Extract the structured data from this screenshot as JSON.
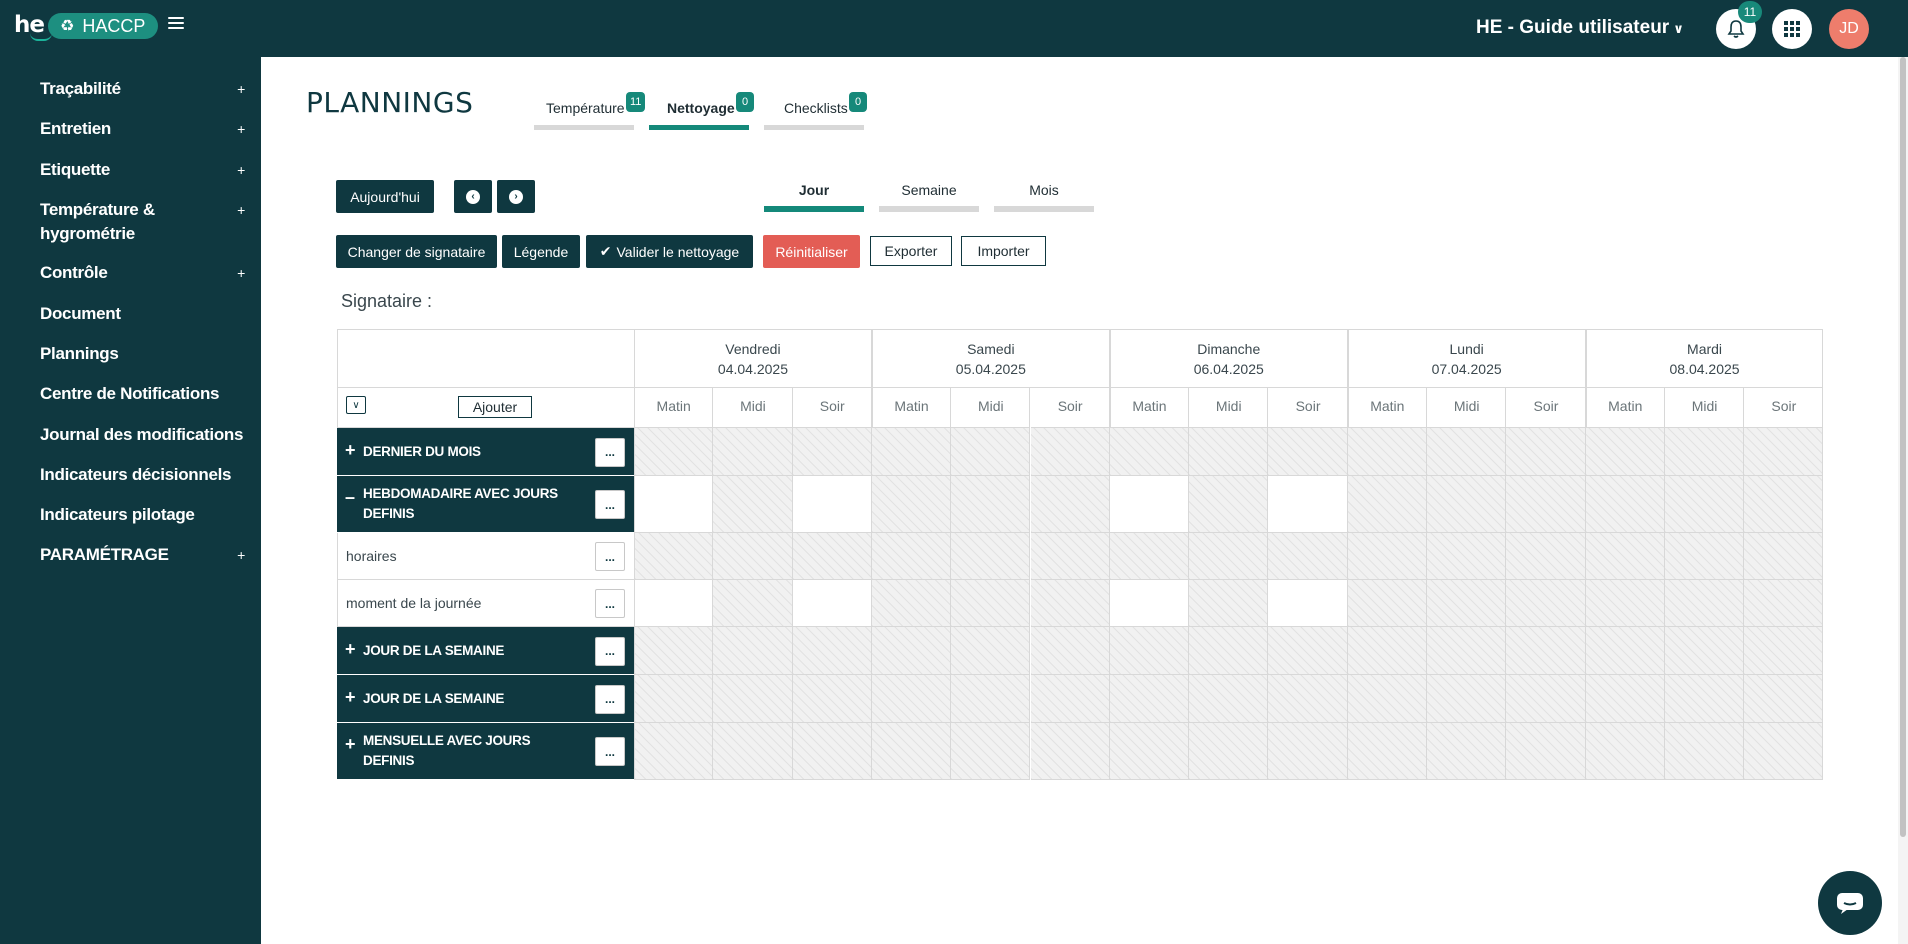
{
  "header": {
    "logo_text": "he",
    "app_name": "HACCP",
    "user_guide": "HE - Guide utilisateur",
    "notification_count": "11",
    "avatar_initials": "JD"
  },
  "sidebar": {
    "items": [
      {
        "label": "Traçabilité",
        "expandable": "+"
      },
      {
        "label": "Entretien",
        "expandable": "+"
      },
      {
        "label": "Etiquette",
        "expandable": "+"
      },
      {
        "label": "Température &",
        "label2": "hygrométrie",
        "expandable": "+"
      },
      {
        "label": "Contrôle",
        "expandable": "+"
      },
      {
        "label": "Document"
      },
      {
        "label": "Plannings"
      },
      {
        "label": "Centre de Notifications"
      },
      {
        "label": "Journal des modifications"
      },
      {
        "label": "Indicateurs décisionnels"
      },
      {
        "label": "Indicateurs pilotage"
      },
      {
        "label": "PARAMÉTRAGE",
        "expandable": "+"
      }
    ]
  },
  "main": {
    "title": "PLANNINGS",
    "tabs": [
      {
        "label": "Température",
        "badge": "11",
        "active": false
      },
      {
        "label": "Nettoyage",
        "badge": "0",
        "active": true
      },
      {
        "label": "Checklists",
        "badge": "0",
        "active": false
      }
    ],
    "today_button": "Aujourd'hui",
    "views": [
      {
        "label": "Jour",
        "active": true
      },
      {
        "label": "Semaine",
        "active": false
      },
      {
        "label": "Mois",
        "active": false
      }
    ],
    "actions": {
      "change_signer": "Changer de signataire",
      "legend": "Légende",
      "validate": "Valider le nettoyage",
      "reset": "Réinitialiser",
      "export": "Exporter",
      "import": "Importer"
    },
    "signataire_label": "Signataire :",
    "add_button": "Ajouter",
    "days": [
      {
        "name": "Vendredi",
        "date": "04.04.2025"
      },
      {
        "name": "Samedi",
        "date": "05.04.2025"
      },
      {
        "name": "Dimanche",
        "date": "06.04.2025"
      },
      {
        "name": "Lundi",
        "date": "07.04.2025"
      },
      {
        "name": "Mardi",
        "date": "08.04.2025"
      }
    ],
    "slots": [
      "Matin",
      "Midi",
      "Soir"
    ],
    "rows": [
      {
        "type": "group",
        "sign": "+",
        "label": "DERNIER DU MOIS",
        "label2": ""
      },
      {
        "type": "group",
        "sign": "–",
        "label": "HEBDOMADAIRE AVEC JOURS",
        "label2": "DEFINIS"
      },
      {
        "type": "item",
        "label": "horaires"
      },
      {
        "type": "item",
        "label": "moment de la journée"
      },
      {
        "type": "group",
        "sign": "+",
        "label": "JOUR DE LA SEMAINE",
        "label2": ""
      },
      {
        "type": "group",
        "sign": "+",
        "label": "JOUR DE LA SEMAINE",
        "label2": ""
      },
      {
        "type": "group",
        "sign": "+",
        "label": "MENSUELLE AVEC JOURS",
        "label2": "DEFINIS"
      }
    ],
    "row_button": "..."
  }
}
